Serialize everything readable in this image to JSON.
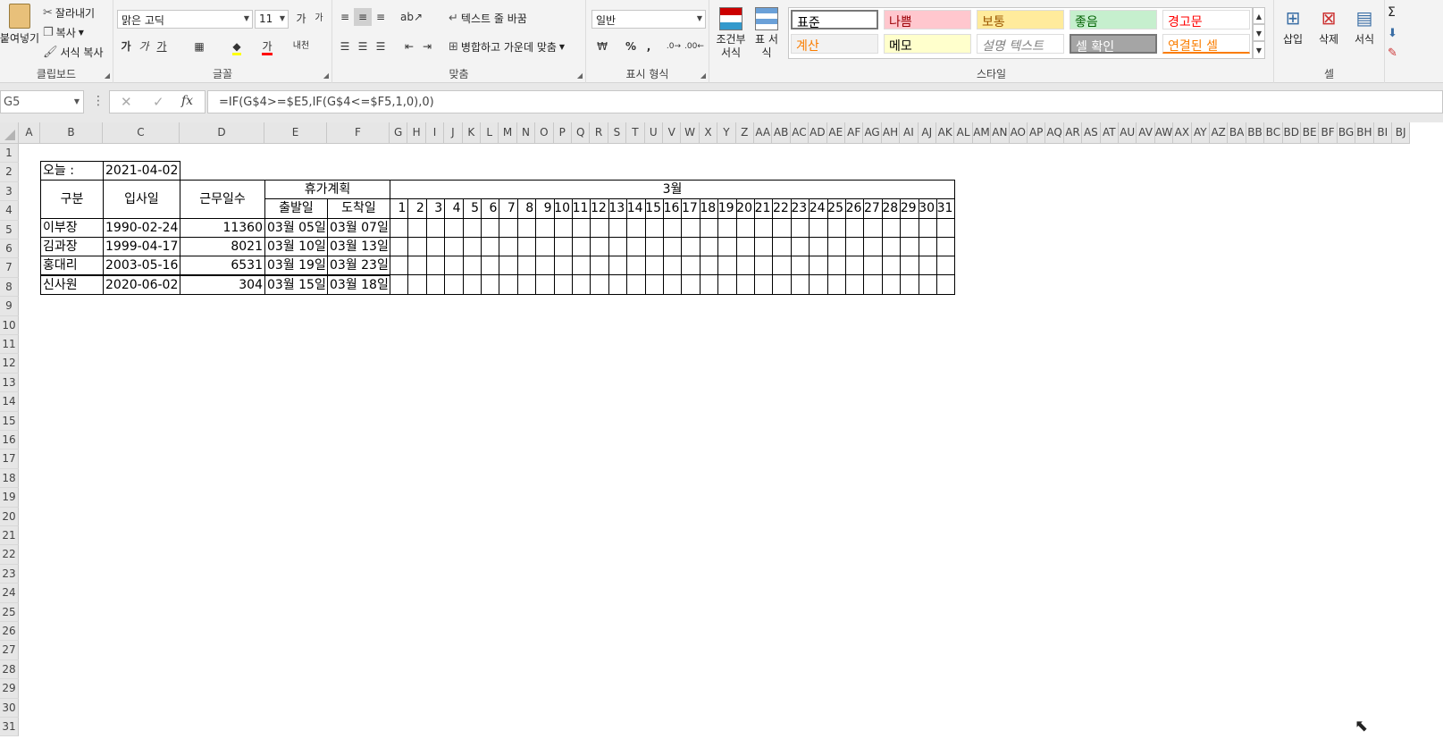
{
  "ribbon": {
    "clipboard": {
      "paste": "붙여넣기",
      "cut": "잘라내기",
      "copy": "복사",
      "format_painter": "서식 복사",
      "label": "클립보드"
    },
    "font": {
      "name": "맑은 고딕",
      "size": "11",
      "label": "글꼴",
      "bold": "가",
      "italic": "가",
      "underline": "가",
      "increase": "가",
      "decrease": "가",
      "phonetic": "내천"
    },
    "alignment": {
      "wrap": "텍스트 줄 바꿈",
      "merge": "병합하고 가운데 맞춤",
      "label": "맞춤"
    },
    "number": {
      "format": "일반",
      "percent": "%",
      "comma": ",",
      "label": "표시 형식"
    },
    "styles": {
      "conditional": "조건부 서식",
      "table": "표 서식",
      "label": "스타일",
      "items": [
        {
          "text": "표준",
          "color": "#000000",
          "bg": "#ffffff"
        },
        {
          "text": "나쁨",
          "color": "#9c0006",
          "bg": "#ffc7ce"
        },
        {
          "text": "보통",
          "color": "#9c5700",
          "bg": "#ffeb9c"
        },
        {
          "text": "좋음",
          "color": "#006100",
          "bg": "#c6efce"
        },
        {
          "text": "경고문",
          "color": "#ff0000",
          "bg": "#ffffff"
        },
        {
          "text": "계산",
          "color": "#fa7d00",
          "bg": "#f2f2f2"
        },
        {
          "text": "메모",
          "color": "#000000",
          "bg": "#ffffcc"
        },
        {
          "text": "설명 텍스트",
          "color": "#7f7f7f",
          "bg": "#ffffff"
        },
        {
          "text": "셀 확인",
          "color": "#ffffff",
          "bg": "#a5a5a5"
        },
        {
          "text": "연결된 셀",
          "color": "#fa7d00",
          "bg": "#ffffff"
        }
      ]
    },
    "cells": {
      "insert": "삽입",
      "delete": "삭제",
      "format": "서식",
      "label": "셀"
    }
  },
  "formula_bar": {
    "name_box": "G5",
    "formula": "=IF(G$4>=$E5,IF(G$4<=$F5,1,0),0)",
    "fx": "fx"
  },
  "columns": [
    "A",
    "B",
    "C",
    "D",
    "E",
    "F",
    "G",
    "H",
    "I",
    "J",
    "K",
    "L",
    "M",
    "N",
    "O",
    "P",
    "Q",
    "R",
    "S",
    "T",
    "U",
    "V",
    "W",
    "X",
    "Y",
    "Z",
    "AA",
    "AB",
    "AC",
    "AD",
    "AE",
    "AF",
    "AG",
    "AH",
    "AI",
    "AJ",
    "AK",
    "AL",
    "AM",
    "AN",
    "AO",
    "AP",
    "AQ",
    "AR",
    "AS",
    "AT",
    "AU",
    "AV",
    "AW",
    "AX",
    "AY",
    "AZ",
    "BA",
    "BB",
    "BC",
    "BD",
    "BE",
    "BF",
    "BG",
    "BH",
    "BI",
    "BJ"
  ],
  "rows": [
    "1",
    "2",
    "3",
    "4",
    "5",
    "6",
    "7",
    "8",
    "9",
    "10",
    "11",
    "12",
    "13",
    "14",
    "15",
    "16",
    "17",
    "18",
    "19",
    "20",
    "21",
    "22",
    "23",
    "24",
    "25",
    "26",
    "27",
    "28",
    "29",
    "30",
    "31"
  ],
  "table": {
    "today_label": "오늘 :",
    "today_value": "2021-04-02",
    "h_category": "구분",
    "h_join": "입사일",
    "h_days": "근무일수",
    "h_plan": "휴가계획",
    "h_month": "3월",
    "h_depart": "출발일",
    "h_arrive": "도착일",
    "days": [
      "1",
      "2",
      "3",
      "4",
      "5",
      "6",
      "7",
      "8",
      "9",
      "10",
      "11",
      "12",
      "13",
      "14",
      "15",
      "16",
      "17",
      "18",
      "19",
      "20",
      "21",
      "22",
      "23",
      "24",
      "25",
      "26",
      "27",
      "28",
      "29",
      "30",
      "31"
    ],
    "employees": [
      {
        "name": "이부장",
        "join": "1990-02-24",
        "days": "11360",
        "depart": "03월 05일",
        "arrive": "03월 07일"
      },
      {
        "name": "김과장",
        "join": "1999-04-17",
        "days": "8021",
        "depart": "03월 10일",
        "arrive": "03월 13일"
      },
      {
        "name": "홍대리",
        "join": "2003-05-16",
        "days": "6531",
        "depart": "03월 19일",
        "arrive": "03월 23일"
      },
      {
        "name": "신사원",
        "join": "2020-06-02",
        "days": "304",
        "depart": "03월 15일",
        "arrive": "03월 18일"
      }
    ]
  }
}
